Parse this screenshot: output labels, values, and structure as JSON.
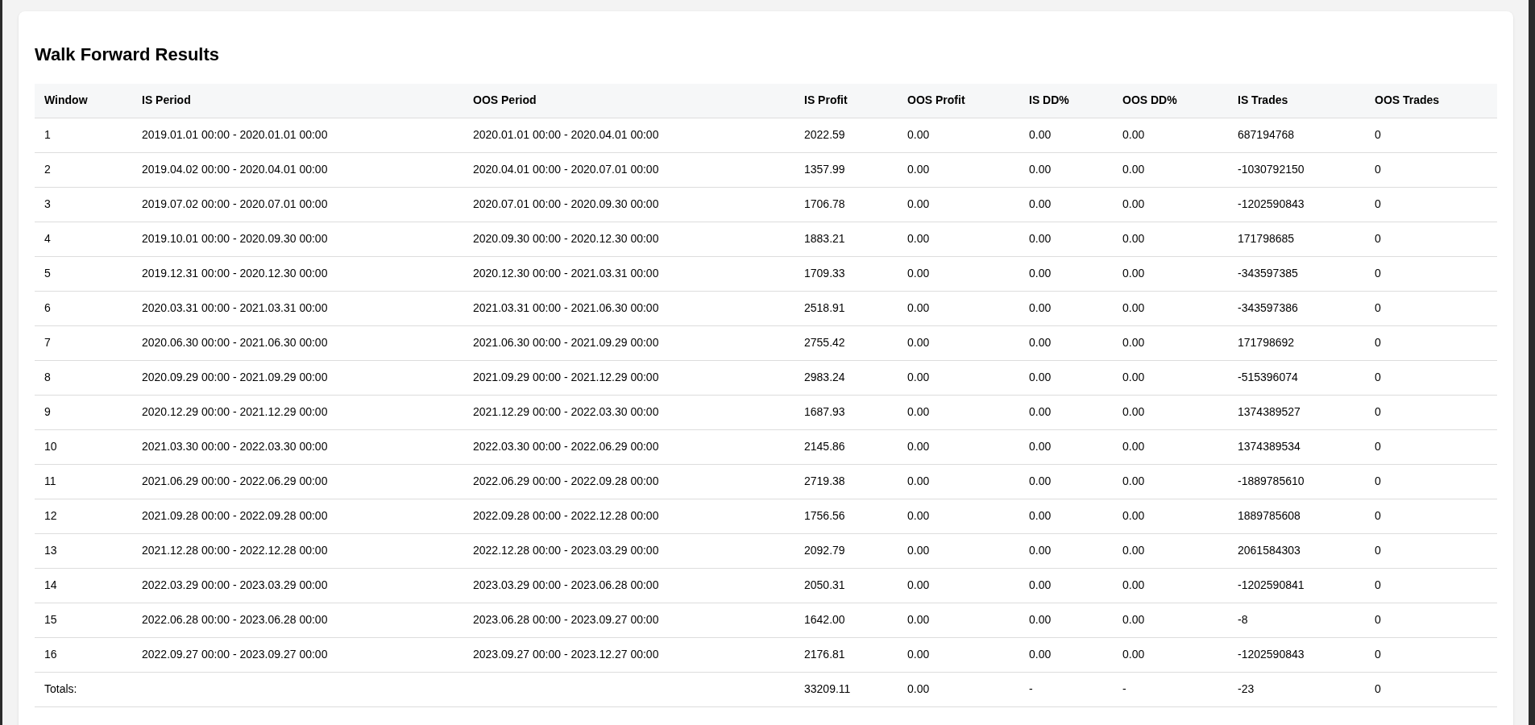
{
  "title": "Walk Forward Results",
  "table": {
    "columns": [
      "Window",
      "IS Period",
      "OOS Period",
      "IS Profit",
      "OOS Profit",
      "IS DD%",
      "OOS DD%",
      "IS Trades",
      "OOS Trades"
    ],
    "rows": [
      [
        "1",
        "2019.01.01 00:00 - 2020.01.01 00:00",
        "2020.01.01 00:00 - 2020.04.01 00:00",
        "2022.59",
        "0.00",
        "0.00",
        "0.00",
        "687194768",
        "0"
      ],
      [
        "2",
        "2019.04.02 00:00 - 2020.04.01 00:00",
        "2020.04.01 00:00 - 2020.07.01 00:00",
        "1357.99",
        "0.00",
        "0.00",
        "0.00",
        "-1030792150",
        "0"
      ],
      [
        "3",
        "2019.07.02 00:00 - 2020.07.01 00:00",
        "2020.07.01 00:00 - 2020.09.30 00:00",
        "1706.78",
        "0.00",
        "0.00",
        "0.00",
        "-1202590843",
        "0"
      ],
      [
        "4",
        "2019.10.01 00:00 - 2020.09.30 00:00",
        "2020.09.30 00:00 - 2020.12.30 00:00",
        "1883.21",
        "0.00",
        "0.00",
        "0.00",
        "171798685",
        "0"
      ],
      [
        "5",
        "2019.12.31 00:00 - 2020.12.30 00:00",
        "2020.12.30 00:00 - 2021.03.31 00:00",
        "1709.33",
        "0.00",
        "0.00",
        "0.00",
        "-343597385",
        "0"
      ],
      [
        "6",
        "2020.03.31 00:00 - 2021.03.31 00:00",
        "2021.03.31 00:00 - 2021.06.30 00:00",
        "2518.91",
        "0.00",
        "0.00",
        "0.00",
        "-343597386",
        "0"
      ],
      [
        "7",
        "2020.06.30 00:00 - 2021.06.30 00:00",
        "2021.06.30 00:00 - 2021.09.29 00:00",
        "2755.42",
        "0.00",
        "0.00",
        "0.00",
        "171798692",
        "0"
      ],
      [
        "8",
        "2020.09.29 00:00 - 2021.09.29 00:00",
        "2021.09.29 00:00 - 2021.12.29 00:00",
        "2983.24",
        "0.00",
        "0.00",
        "0.00",
        "-515396074",
        "0"
      ],
      [
        "9",
        "2020.12.29 00:00 - 2021.12.29 00:00",
        "2021.12.29 00:00 - 2022.03.30 00:00",
        "1687.93",
        "0.00",
        "0.00",
        "0.00",
        "1374389527",
        "0"
      ],
      [
        "10",
        "2021.03.30 00:00 - 2022.03.30 00:00",
        "2022.03.30 00:00 - 2022.06.29 00:00",
        "2145.86",
        "0.00",
        "0.00",
        "0.00",
        "1374389534",
        "0"
      ],
      [
        "11",
        "2021.06.29 00:00 - 2022.06.29 00:00",
        "2022.06.29 00:00 - 2022.09.28 00:00",
        "2719.38",
        "0.00",
        "0.00",
        "0.00",
        "-1889785610",
        "0"
      ],
      [
        "12",
        "2021.09.28 00:00 - 2022.09.28 00:00",
        "2022.09.28 00:00 - 2022.12.28 00:00",
        "1756.56",
        "0.00",
        "0.00",
        "0.00",
        "1889785608",
        "0"
      ],
      [
        "13",
        "2021.12.28 00:00 - 2022.12.28 00:00",
        "2022.12.28 00:00 - 2023.03.29 00:00",
        "2092.79",
        "0.00",
        "0.00",
        "0.00",
        "2061584303",
        "0"
      ],
      [
        "14",
        "2022.03.29 00:00 - 2023.03.29 00:00",
        "2023.03.29 00:00 - 2023.06.28 00:00",
        "2050.31",
        "0.00",
        "0.00",
        "0.00",
        "-1202590841",
        "0"
      ],
      [
        "15",
        "2022.06.28 00:00 - 2023.06.28 00:00",
        "2023.06.28 00:00 - 2023.09.27 00:00",
        "1642.00",
        "0.00",
        "0.00",
        "0.00",
        "-8",
        "0"
      ],
      [
        "16",
        "2022.09.27 00:00 - 2023.09.27 00:00",
        "2023.09.27 00:00 - 2023.12.27 00:00",
        "2176.81",
        "0.00",
        "0.00",
        "0.00",
        "-1202590843",
        "0"
      ]
    ],
    "totals": {
      "label": "Totals:",
      "cells": [
        "33209.11",
        "0.00",
        "-",
        "-",
        "-23",
        "0"
      ]
    }
  }
}
